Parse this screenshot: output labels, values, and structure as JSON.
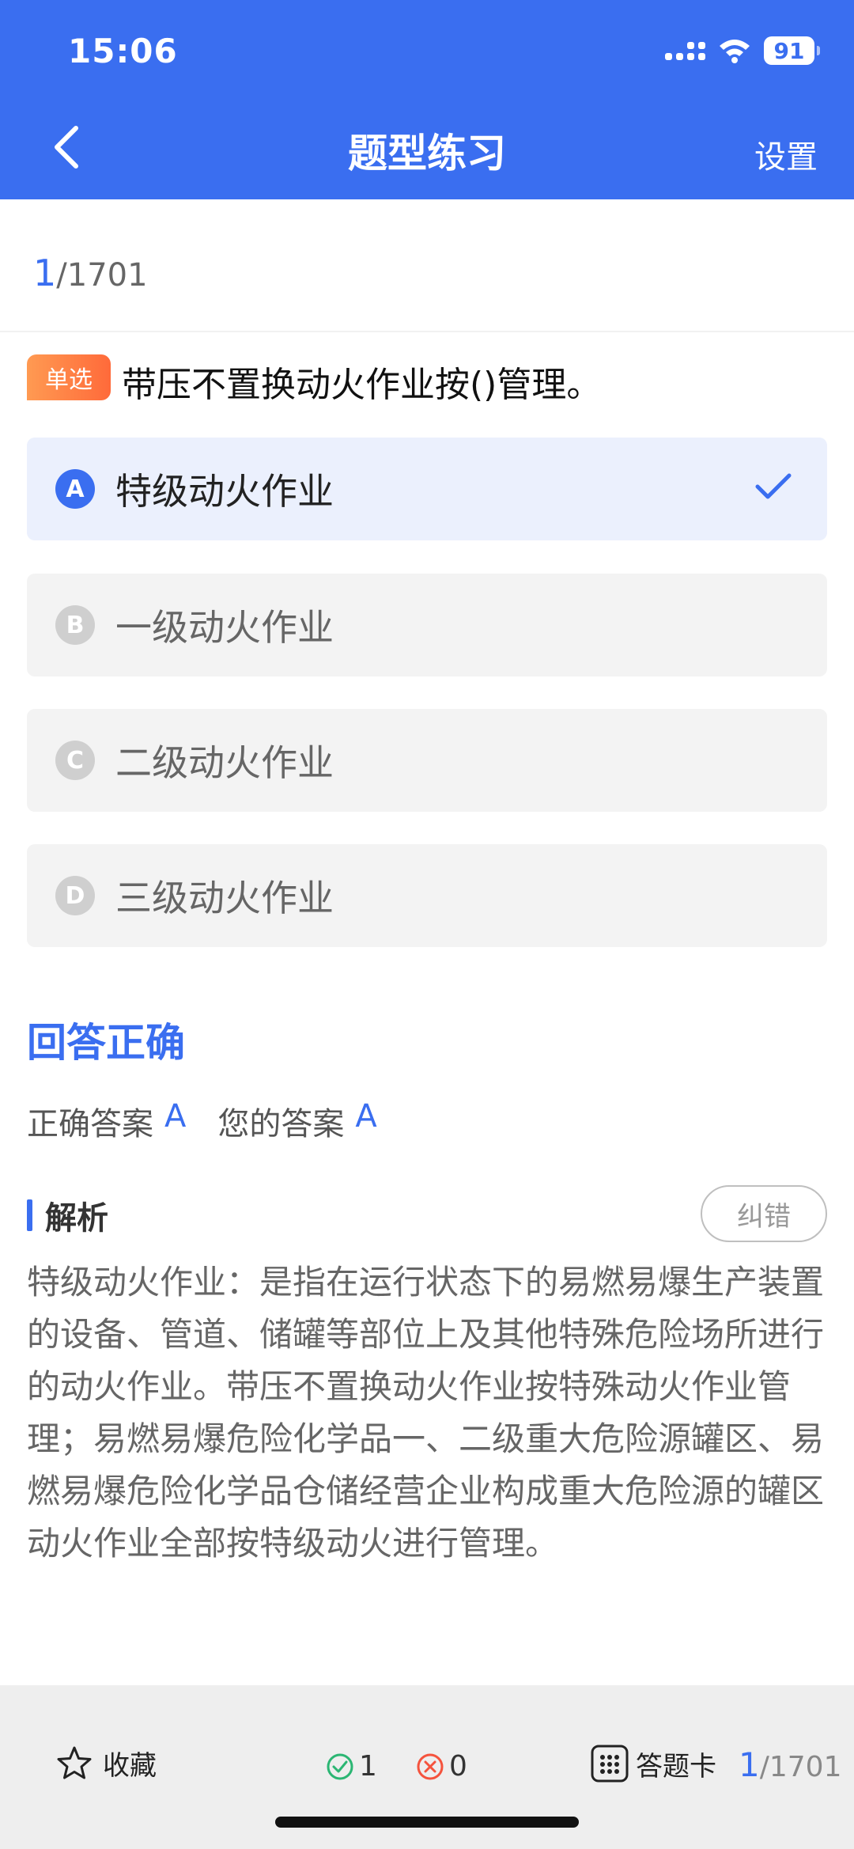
{
  "status_bar": {
    "time": "15:06",
    "battery": "91"
  },
  "nav": {
    "title": "题型练习",
    "setting": "设置"
  },
  "progress": {
    "current": "1",
    "total": "/1701"
  },
  "question": {
    "type": "单选",
    "text": "带压不置换动火作业按()管理。",
    "options": [
      {
        "letter": "A",
        "text": "特级动火作业",
        "selected": true
      },
      {
        "letter": "B",
        "text": "一级动火作业",
        "selected": false
      },
      {
        "letter": "C",
        "text": "二级动火作业",
        "selected": false
      },
      {
        "letter": "D",
        "text": "三级动火作业",
        "selected": false
      }
    ]
  },
  "result": {
    "status": "回答正确",
    "correct_label": "正确答案",
    "correct_value": "A",
    "yours_label": "您的答案",
    "yours_value": "A"
  },
  "analysis": {
    "title": "解析",
    "report": "纠错",
    "body": "特级动火作业：是指在运行状态下的易燃易爆生产装置的设备、管道、储罐等部位上及其他特殊危险场所进行的动火作业。带压不置换动火作业按特殊动火作业管理；易燃易爆危险化学品一、二级重大危险源罐区、易燃易爆危险化学品仓储经营企业构成重大危险源的罐区动火作业全部按特级动火进行管理。"
  },
  "bottom": {
    "favorite": "收藏",
    "correct_count": "1",
    "wrong_count": "0",
    "answer_card": "答题卡",
    "progress_current": "1",
    "progress_total": "/1701"
  },
  "colors": {
    "accent": "#3a6ef0",
    "type_tag": "#ff7a40",
    "correct": "#2bb673",
    "wrong": "#f5533d"
  }
}
